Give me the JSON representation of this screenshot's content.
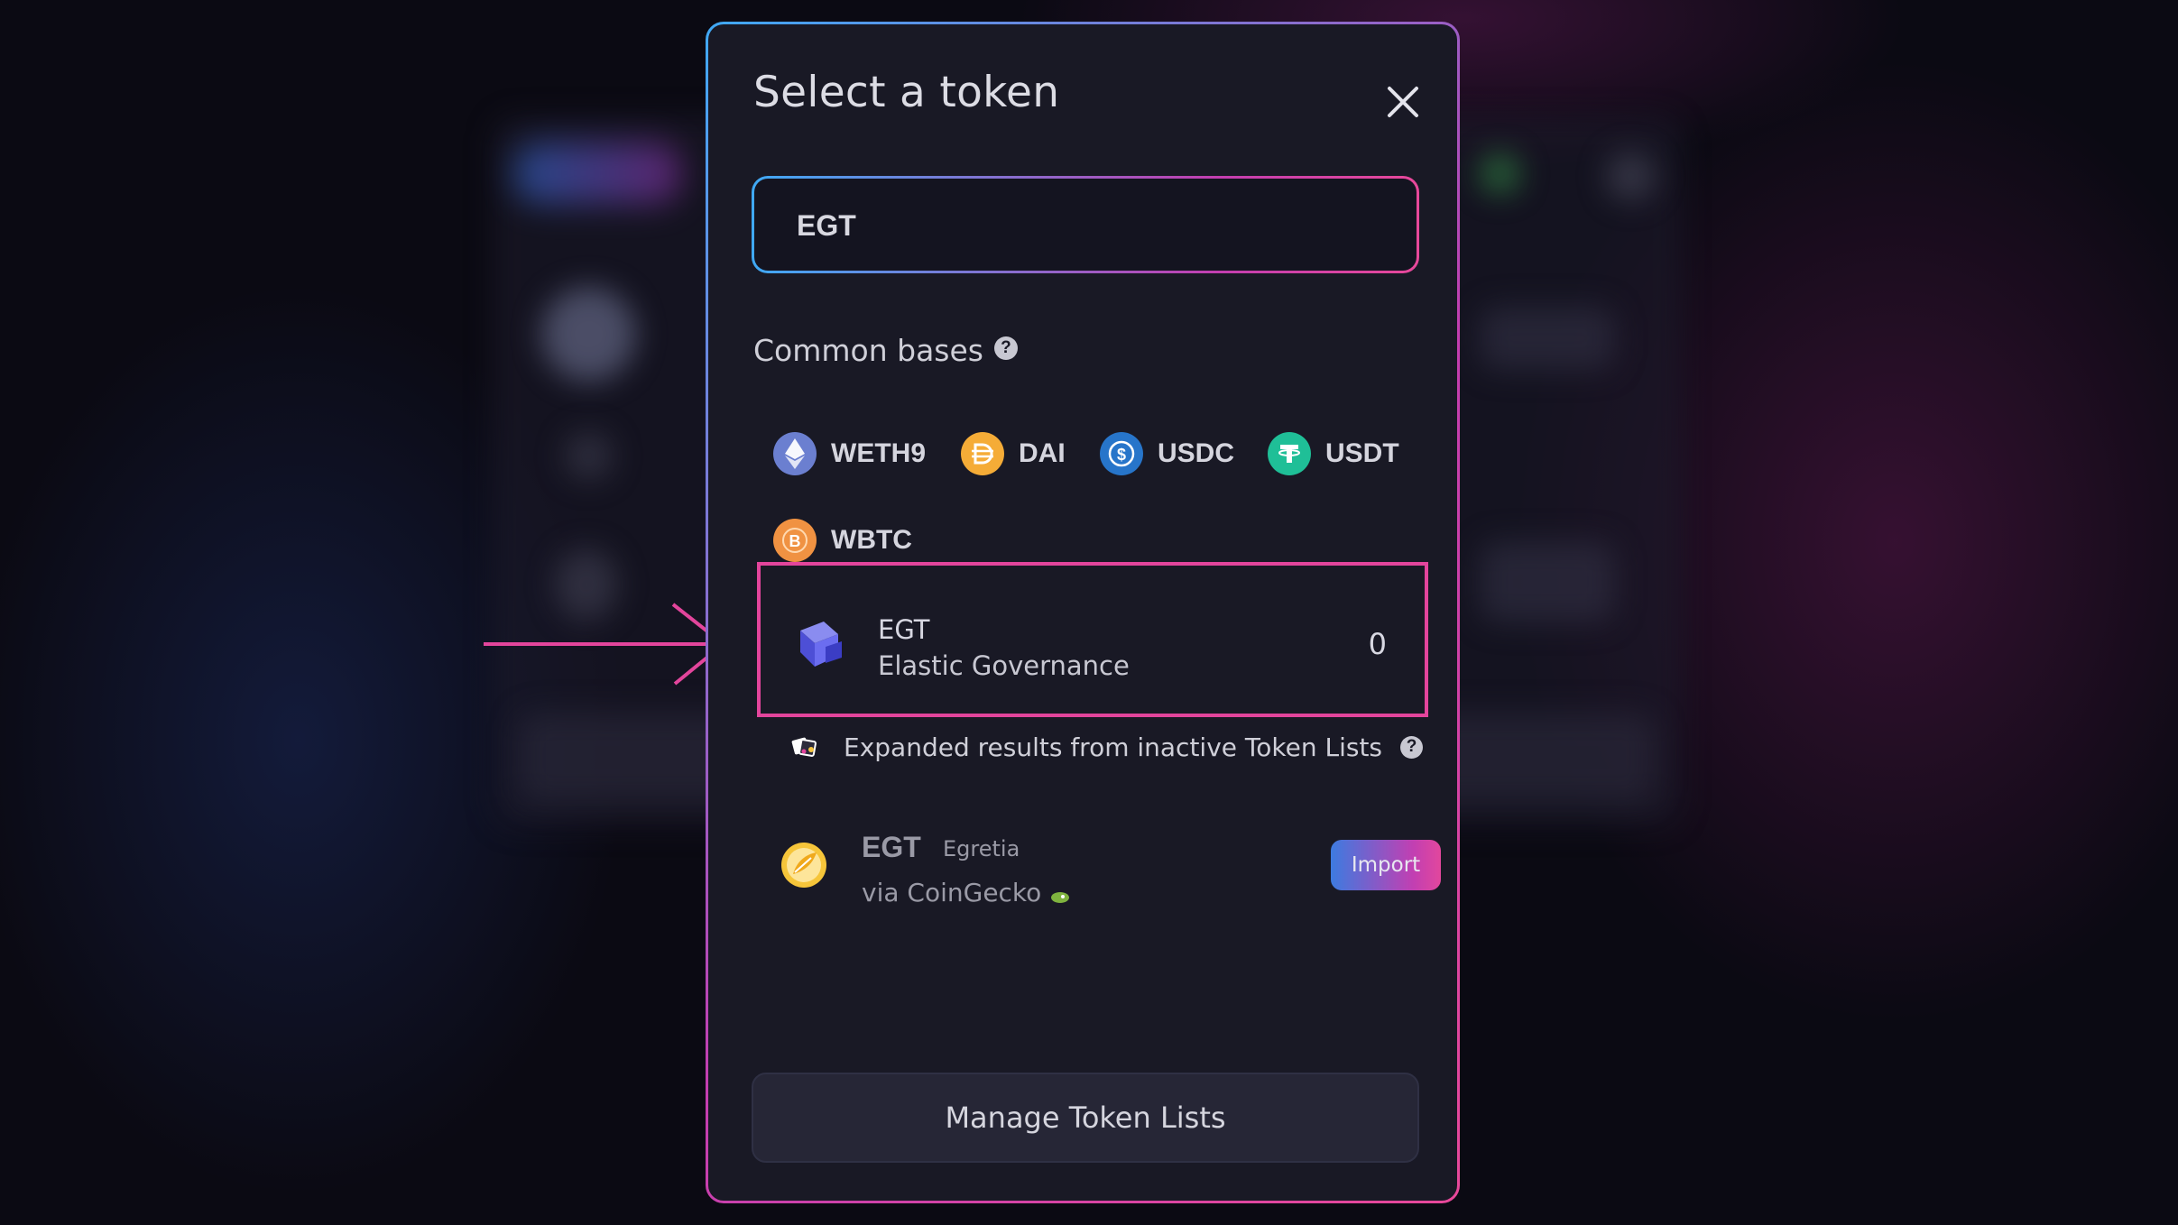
{
  "modal": {
    "title": "Select a token"
  },
  "search": {
    "value": "EGT",
    "placeholder": ""
  },
  "common_bases": {
    "label": "Common bases",
    "tokens": [
      {
        "symbol": "WETH9",
        "icon": "ethereum-icon",
        "color": "#627eea"
      },
      {
        "symbol": "DAI",
        "icon": "dai-icon",
        "color": "#f5ac37"
      },
      {
        "symbol": "USDC",
        "icon": "usdc-icon",
        "color": "#2775ca"
      },
      {
        "symbol": "USDT",
        "icon": "tether-icon",
        "color": "#26a17b"
      },
      {
        "symbol": "WBTC",
        "icon": "bitcoin-icon",
        "color": "#f09242"
      }
    ]
  },
  "results": {
    "active": {
      "symbol": "EGT",
      "name": "Elastic Governance",
      "balance": "0",
      "icon": "cube-icon"
    },
    "expanded_note": "Expanded results from inactive Token Lists",
    "inactive": {
      "symbol": "EGT",
      "name": "Egretia",
      "source": "via CoinGecko",
      "import_label": "Import",
      "icon": "egretia-icon"
    }
  },
  "footer": {
    "manage_label": "Manage Token Lists"
  },
  "colors": {
    "highlight": "#e3459c",
    "modal_bg": "#191925",
    "accent_blue": "#3fa9f5",
    "accent_pink": "#e8489a"
  }
}
